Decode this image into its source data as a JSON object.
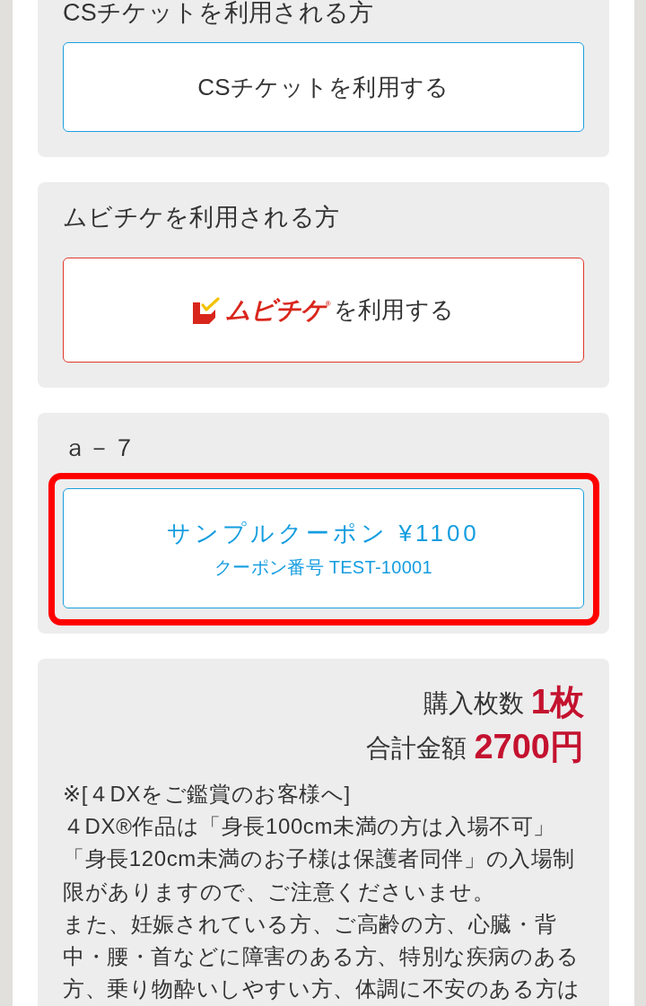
{
  "sections": [
    {
      "kind": "cs_ticket",
      "title": "CSチケットを利用される方",
      "button": {
        "label": "CSチケットを利用する"
      }
    },
    {
      "kind": "movie_ticket",
      "title": "ムビチケを利用される方",
      "button": {
        "logo_text": "ムビチケ$^{®}$",
        "label": "を利用する"
      }
    },
    {
      "kind": "coupon",
      "title": "ａ－７",
      "button": {
        "label": "サンプルクーポン ¥1100",
        "sublabel": "クーポン番号 TEST-10001",
        "highlighted": true
      }
    }
  ],
  "summary": {
    "rows": [
      {
        "label": "購入枚数",
        "value": "1枚"
      },
      {
        "label": "合計金額",
        "value": "2700円"
      }
    ],
    "notes": [
      "※[４DXをご鑑賞のお客様へ]",
      "４DX®作品は「身長100cm未満の方は入場不可」「身長120cm未満のお子様は保護者同伴」の入場制限がありますので、ご注意くださいませ。",
      "また、妊娠されている方、ご高齢の方、心臓・背中・腰・首などに障害のある方、特別な疾病のある方、乗り物酔いしやすい方、体調に不安のある方は"
    ]
  }
}
